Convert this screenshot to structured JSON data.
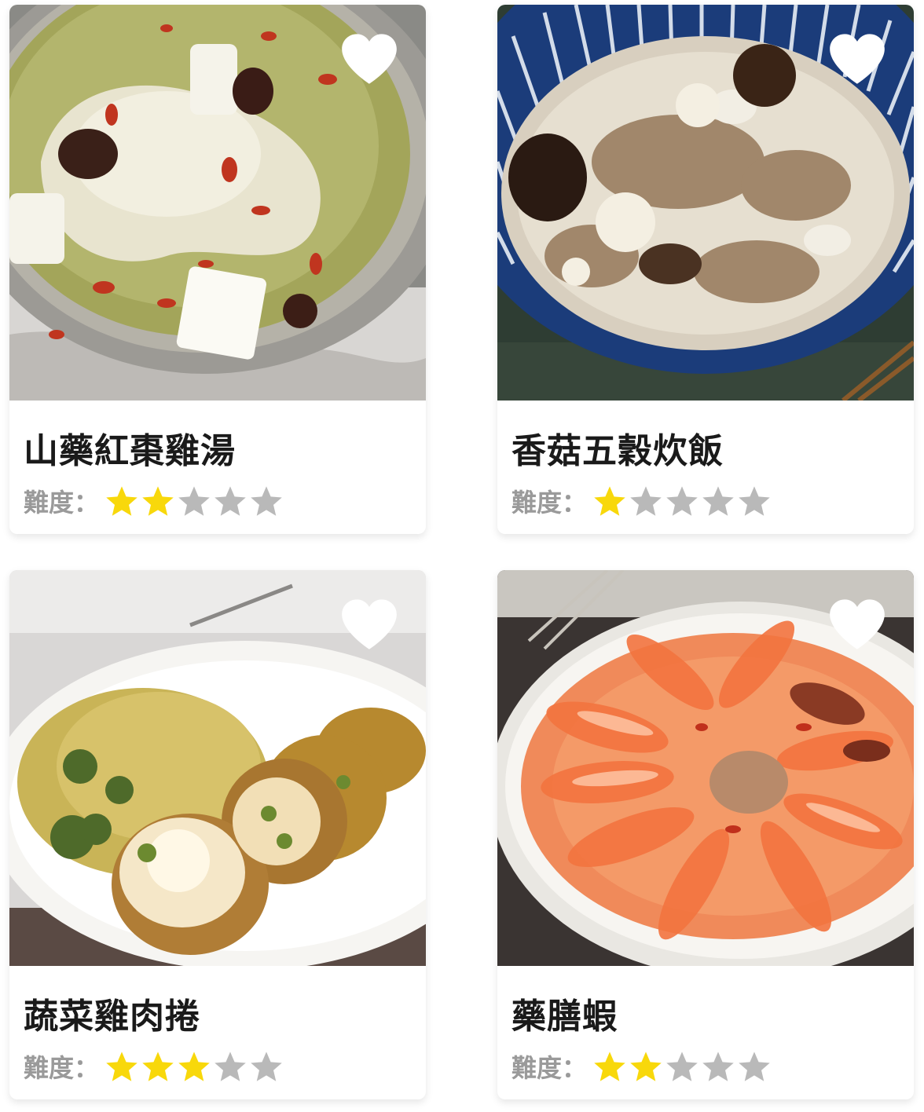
{
  "colors": {
    "star_filled": "#F8D80B",
    "star_empty": "#B9B9B9",
    "heart": "#FFFFFF",
    "title_text": "#1A1A1A",
    "label_text": "#9A9A9A"
  },
  "icons": {
    "favorite": "heart-icon",
    "rating": "star-icon"
  },
  "recipes": [
    {
      "title": "山藥紅棗雞湯",
      "difficulty_label": "難度：",
      "difficulty": 2,
      "difficulty_max": 5,
      "image": "chicken-soup-photo"
    },
    {
      "title": "香菇五穀炊飯",
      "difficulty_label": "難度：",
      "difficulty": 1,
      "difficulty_max": 5,
      "image": "mushroom-rice-photo"
    },
    {
      "title": "蔬菜雞肉捲",
      "difficulty_label": "難度：",
      "difficulty": 3,
      "difficulty_max": 5,
      "image": "chicken-roll-photo"
    },
    {
      "title": "藥膳蝦",
      "difficulty_label": "難度：",
      "difficulty": 2,
      "difficulty_max": 5,
      "image": "herbal-shrimp-photo"
    }
  ]
}
